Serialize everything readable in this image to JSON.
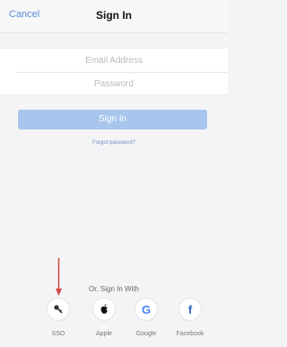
{
  "nav": {
    "cancel_label": "Cancel",
    "title": "Sign In"
  },
  "form": {
    "email_placeholder": "Email Address",
    "password_placeholder": "Password",
    "email_value": "",
    "password_value": ""
  },
  "actions": {
    "signin_label": "Sign In",
    "forgot_label": "Forgot password?"
  },
  "social": {
    "heading": "Or, Sign In With",
    "providers": [
      {
        "label": "SSO",
        "icon": "key-icon"
      },
      {
        "label": "Apple",
        "icon": "apple-icon"
      },
      {
        "label": "Google",
        "icon": "google-icon"
      },
      {
        "label": "Facebook",
        "icon": "facebook-icon"
      }
    ]
  },
  "colors": {
    "accent": "#5b8dd9",
    "button": "#a8c5ee",
    "arrow": "#d64541"
  }
}
